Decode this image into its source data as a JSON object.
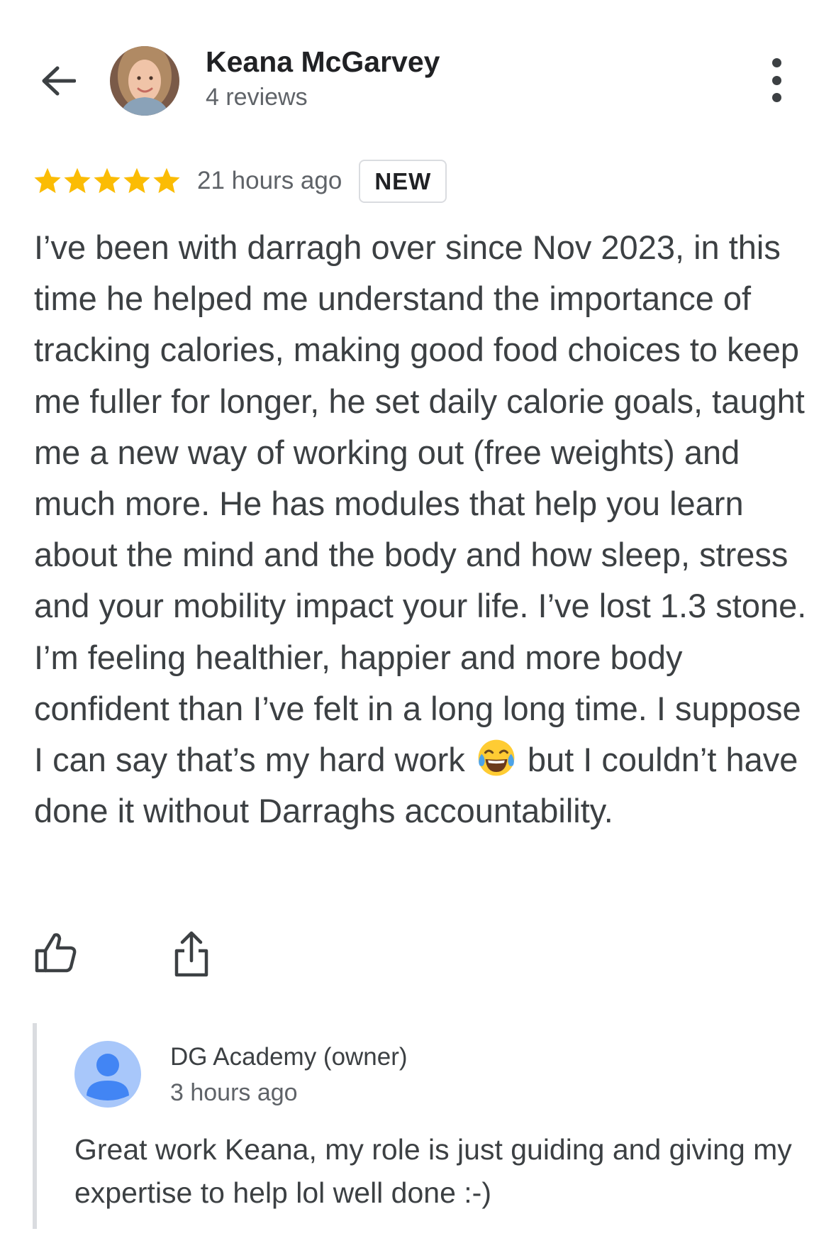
{
  "header": {
    "back_icon": "arrow-back-icon",
    "reviewer_name": "Keana McGarvey",
    "review_count": "4 reviews",
    "more_icon": "more-vertical-icon"
  },
  "review": {
    "rating": 5,
    "max_rating": 5,
    "star_color": "#fbbc04",
    "time_ago": "21 hours ago",
    "badge": "NEW",
    "text_before_emoji": "I’ve been with darragh over since Nov 2023, in this time he helped me understand the importance of tracking calories, making good food choices to keep me fuller for longer, he set daily calorie goals, taught me a new way of working out (free weights) and much more. He has modules that help you learn about the mind and the body and how sleep, stress and your mobility impact your life. I’ve lost 1.3 stone. I’m feeling healthier, happier and more body confident than I’ve felt in a long long time. I suppose I can say that’s my hard work",
    "emoji_icon": "tears-of-joy-emoji-icon",
    "text_after_emoji": "but I couldn’t have done it without Darraghs accountability."
  },
  "actions": {
    "like_icon": "thumbs-up-icon",
    "share_icon": "share-icon"
  },
  "owner_reply": {
    "avatar_icon": "default-person-icon",
    "avatar_color": "#a8c7fa",
    "name": "DG Academy (owner)",
    "time_ago": "3 hours ago",
    "text": "Great work Keana, my role is just guiding and giving my expertise to help lol well done :-)"
  }
}
